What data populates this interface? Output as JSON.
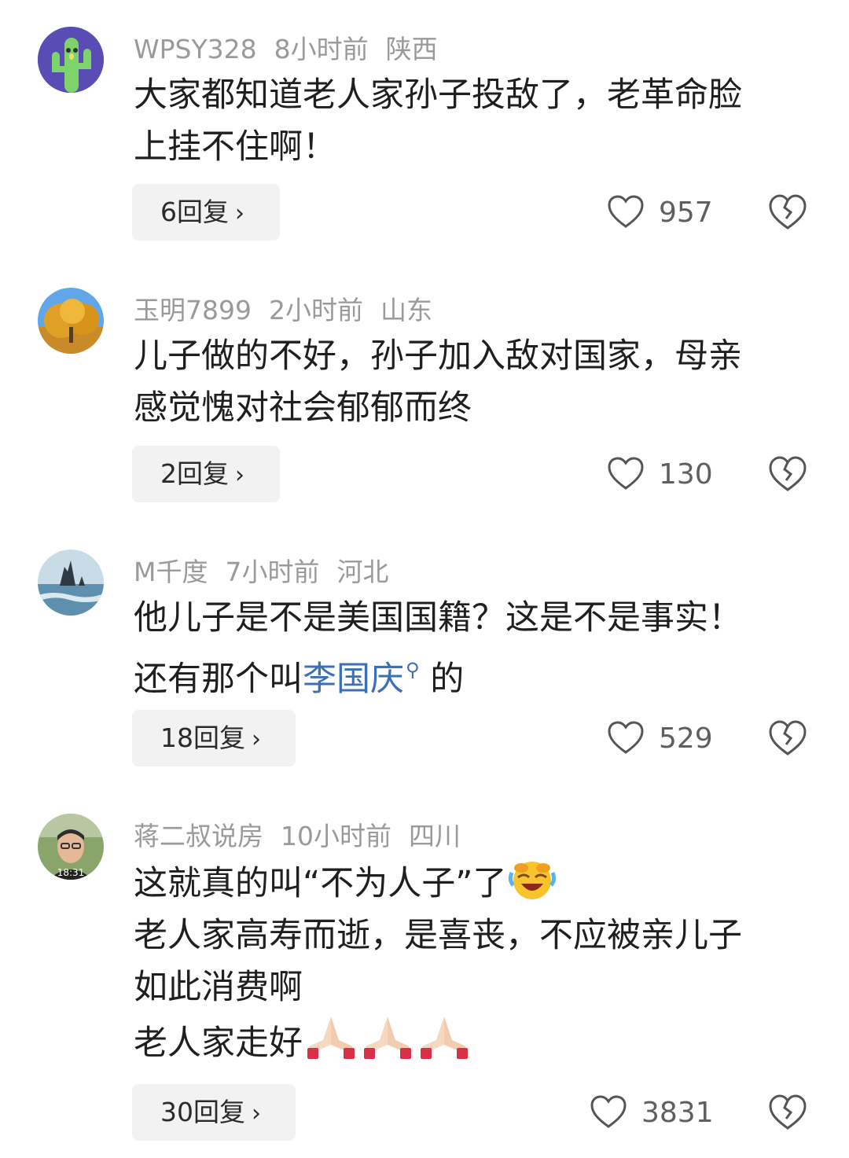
{
  "comments": [
    {
      "username": "WPSY328",
      "time": "8小时前",
      "location": "陕西",
      "text_lines": [
        "大家都知道老人家孙子投敌了，老革命脸",
        "上挂不住啊！"
      ],
      "replies": "6回复",
      "likes": "957",
      "avatar": "cactus-avatar"
    },
    {
      "username": "玉明7899",
      "time": "2小时前",
      "location": "山东",
      "text_lines": [
        "儿子做的不好，孙子加入敌对国家，母亲",
        "感觉愧对社会郁郁而终"
      ],
      "replies": "2回复",
      "likes": "130",
      "avatar": "autumn-tree-avatar"
    },
    {
      "username": "M千度",
      "time": "7小时前",
      "location": "河北",
      "text_line1": "他儿子是不是美国国籍？这是不是事实！",
      "text_line2_prefix": "还有那个叫",
      "text_line2_link": "李国庆",
      "text_line2_suffix": " 的",
      "replies": "18回复",
      "likes": "529",
      "avatar": "seascape-avatar"
    },
    {
      "username": "蒋二叔说房",
      "time": "10小时前",
      "location": "四川",
      "text_line1": "这就真的叫“不为人子”了",
      "text_line2": "老人家高寿而逝，是喜丧，不应被亲儿子",
      "text_line3": "如此消费啊",
      "text_line4": "老人家走好",
      "avatar_time": "18:31",
      "replies": "30回复",
      "likes": "3831",
      "avatar": "man-portrait-avatar"
    }
  ],
  "icons": {
    "like": "heart-outline-icon",
    "dislike": "broken-heart-icon",
    "search": "search-icon",
    "emoji_laugh": "rolling-laughing-emoji",
    "emoji_pray": "praying-hands-emoji"
  },
  "colors": {
    "meta": "#9a9a9a",
    "text": "#1f1f1f",
    "link": "#3b6fb6",
    "reply_bg": "#f2f2f2"
  }
}
